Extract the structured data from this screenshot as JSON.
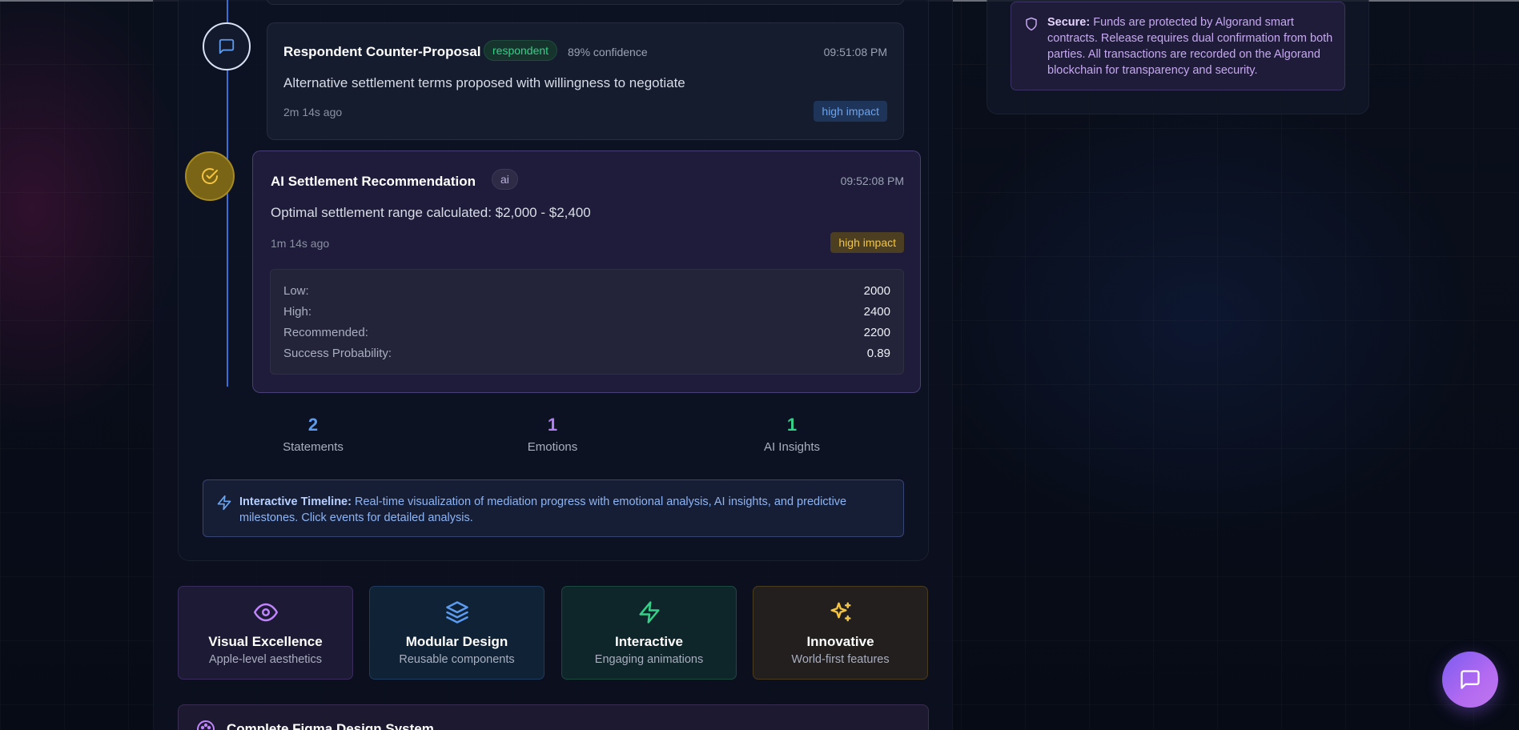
{
  "timeline": {
    "events": [
      {
        "title": "Respondent Counter-Proposal",
        "tag": "respondent",
        "confidence": "89% confidence",
        "time": "09:51:08 PM",
        "description": "Alternative settlement terms proposed with willingness to negotiate",
        "ago": "2m 14s ago",
        "impact": "high impact"
      },
      {
        "title": "AI Settlement Recommendation",
        "tag": "ai",
        "time": "09:52:08 PM",
        "description": "Optimal settlement range calculated: $2,000 - $2,400",
        "ago": "1m 14s ago",
        "impact": "high impact",
        "details": [
          {
            "key": "Low:",
            "value": "2000"
          },
          {
            "key": "High:",
            "value": "2400"
          },
          {
            "key": "Recommended:",
            "value": "2200"
          },
          {
            "key": "Success Probability:",
            "value": "0.89"
          }
        ]
      }
    ],
    "stats": [
      {
        "value": "2",
        "label": "Statements",
        "color": "#5b9bf0"
      },
      {
        "value": "1",
        "label": "Emotions",
        "color": "#b07ef0"
      },
      {
        "value": "1",
        "label": "AI Insights",
        "color": "#34d08a"
      }
    ],
    "info": {
      "label": "Interactive Timeline:",
      "text": " Real-time visualization of mediation progress with emotional analysis, AI insights, and predictive milestones. Click events for detailed analysis."
    }
  },
  "features": [
    {
      "title": "Visual Excellence",
      "subtitle": "Apple-level aesthetics",
      "icon": "eye-icon",
      "color": "#c084fc"
    },
    {
      "title": "Modular Design",
      "subtitle": "Reusable components",
      "icon": "layers-icon",
      "color": "#5b9bf0"
    },
    {
      "title": "Interactive",
      "subtitle": "Engaging animations",
      "icon": "lightning-icon",
      "color": "#34d08a"
    },
    {
      "title": "Innovative",
      "subtitle": "World-first features",
      "icon": "sparkles-icon",
      "color": "#f3c443"
    }
  ],
  "bottom_card": {
    "title": "Complete Figma Design System"
  },
  "secure": {
    "label": "Secure:",
    "text": " Funds are protected by Algorand smart contracts. Release requires dual confirmation from both parties. All transactions are recorded on the Algorand blockchain for transparency and security."
  }
}
